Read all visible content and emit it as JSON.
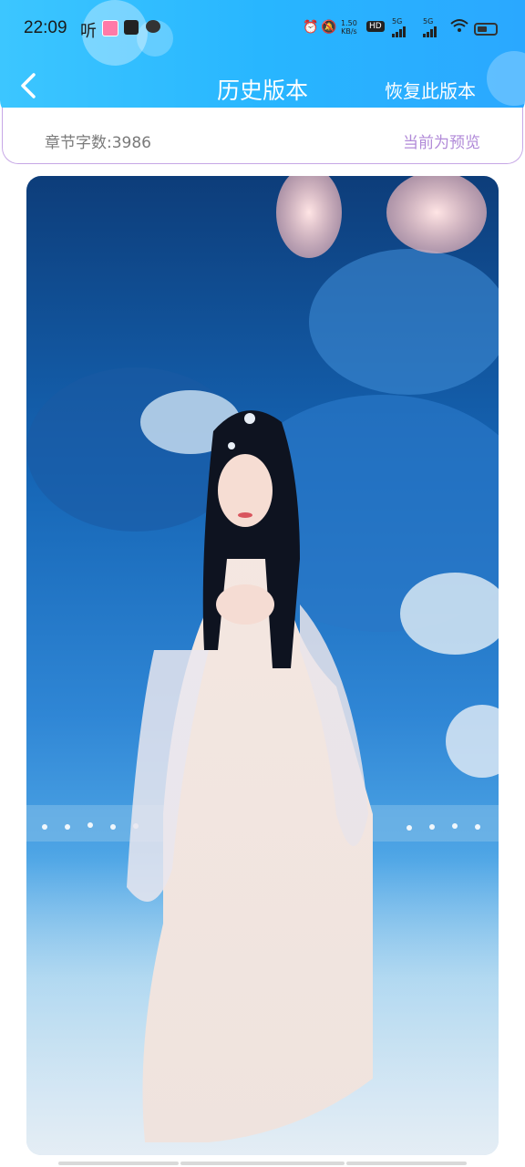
{
  "status_bar": {
    "time": "22:09",
    "listen_label": "听",
    "network_speed_value": "1.50",
    "network_speed_unit": "KB/s",
    "hd_badge": "HD",
    "signal_label_1": "5G",
    "signal_label_2": "5G"
  },
  "header": {
    "title": "历史版本",
    "restore_label": "恢复此版本",
    "accent_color": "#2bb4ff"
  },
  "info": {
    "word_count": "章节字数:3986",
    "preview_status": "当前为预览",
    "preview_color": "#b18ad8"
  }
}
